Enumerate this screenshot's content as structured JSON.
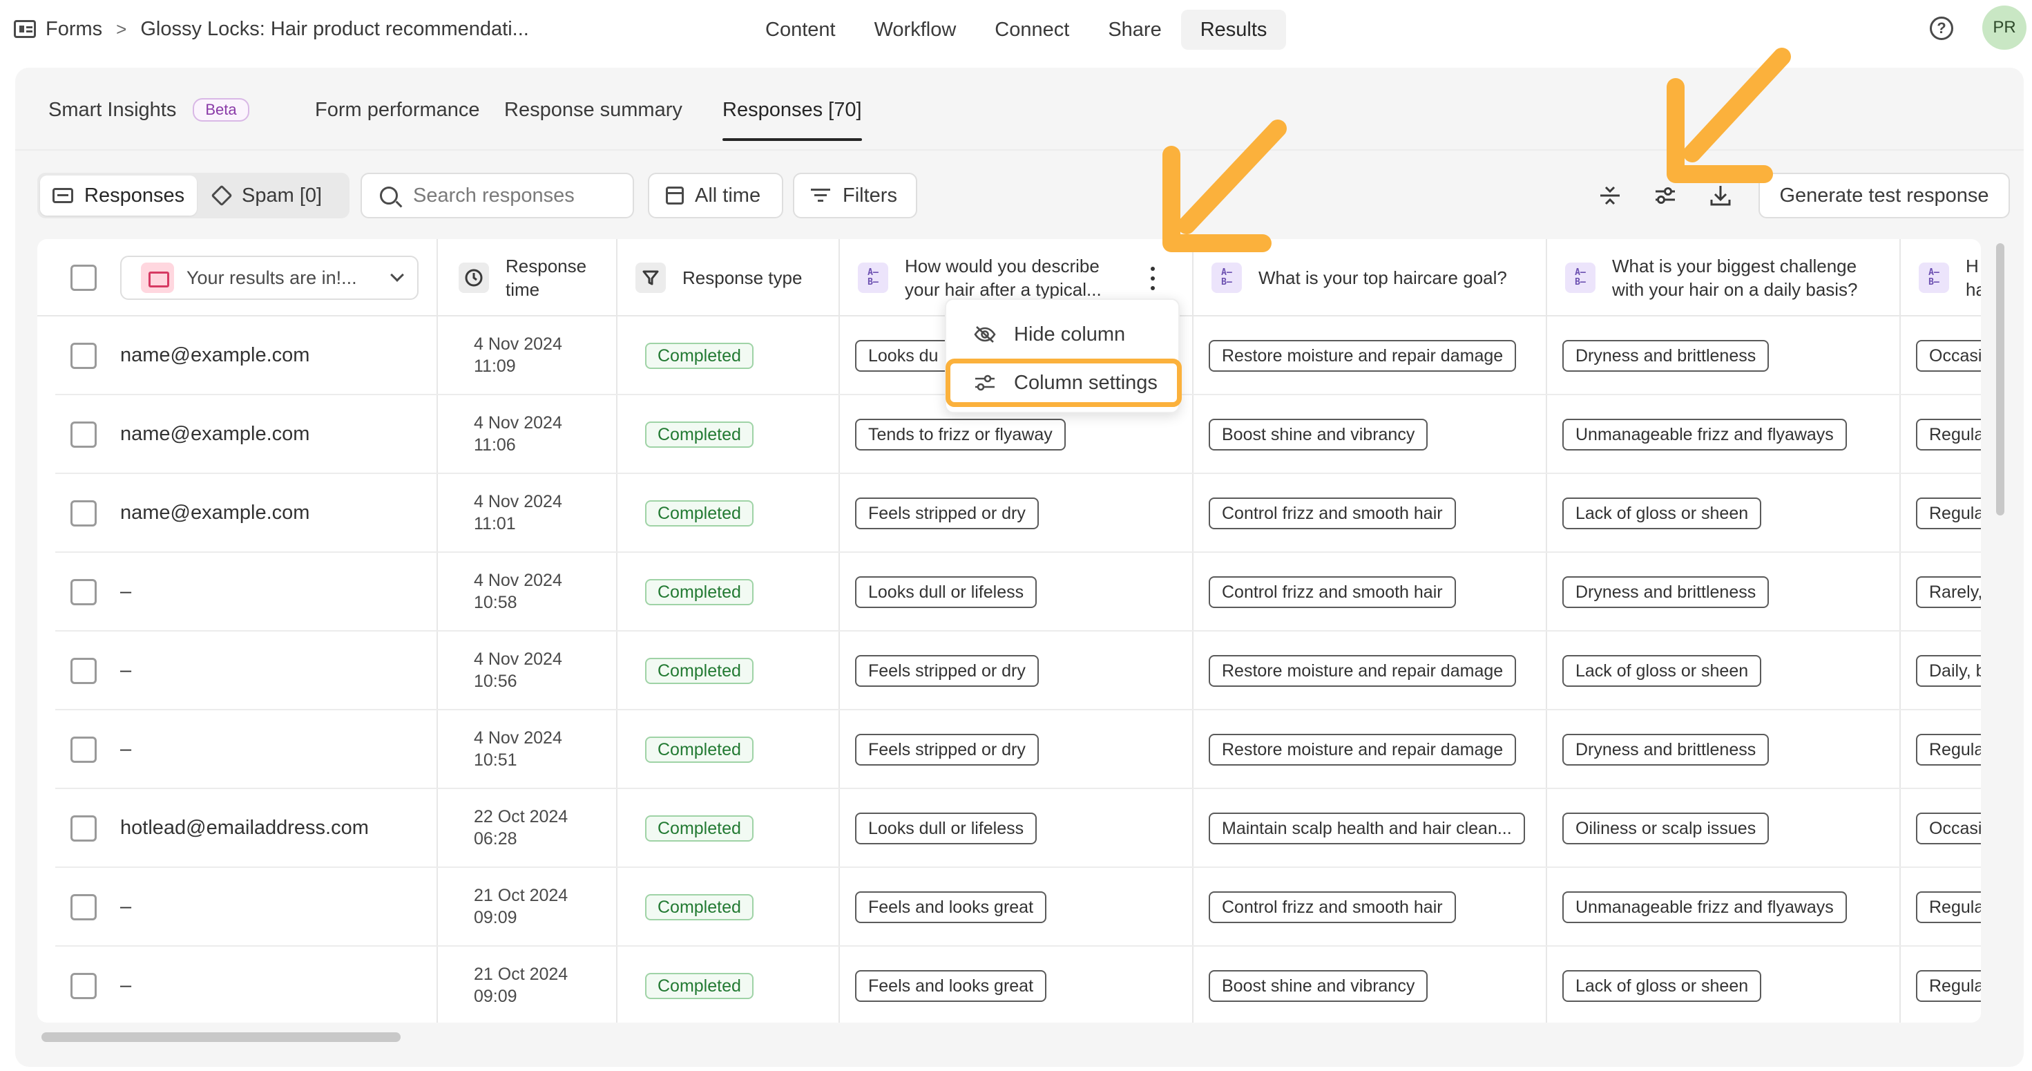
{
  "breadcrumb": {
    "root": "Forms",
    "separator": ">",
    "form_title": "Glossy Locks: Hair product recommendati..."
  },
  "top_nav": [
    {
      "label": "Content",
      "active": false
    },
    {
      "label": "Workflow",
      "active": false
    },
    {
      "label": "Connect",
      "active": false
    },
    {
      "label": "Share",
      "active": false
    },
    {
      "label": "Results",
      "active": true
    }
  ],
  "user": {
    "initials": "PR",
    "help_icon": "question-circle-icon"
  },
  "sub_tabs": {
    "smart_insights": "Smart Insights",
    "beta_badge": "Beta",
    "form_performance": "Form performance",
    "response_summary": "Response summary",
    "responses": "Responses [70]"
  },
  "toolbar": {
    "responses_label": "Responses",
    "spam_label": "Spam [0]",
    "search_placeholder": "Search responses",
    "date_filter": "All time",
    "filters_label": "Filters",
    "generate_label": "Generate test response"
  },
  "table": {
    "email_column": "Your results are in!...",
    "response_time_header": "Response time",
    "response_type_header": "Response type",
    "questions": [
      "How would you describe your hair after a typical...",
      "What is your top haircare goal?",
      "What is your biggest challenge with your hair on a daily basis?",
      "H ha"
    ],
    "rows": [
      {
        "email": "name@example.com",
        "date": "4 Nov 2024",
        "time": "11:09",
        "type": "Completed",
        "q1": "Looks du",
        "q2": "Restore moisture and repair damage",
        "q3": "Dryness and brittleness",
        "q4": "Occasi"
      },
      {
        "email": "name@example.com",
        "date": "4 Nov 2024",
        "time": "11:06",
        "type": "Completed",
        "q1": "Tends to frizz or flyaway",
        "q2": "Boost shine and vibrancy",
        "q3": "Unmanageable frizz and flyaways",
        "q4": "Regula"
      },
      {
        "email": "name@example.com",
        "date": "4 Nov 2024",
        "time": "11:01",
        "type": "Completed",
        "q1": "Feels stripped or dry",
        "q2": "Control frizz and smooth hair",
        "q3": "Lack of gloss or sheen",
        "q4": "Regula"
      },
      {
        "email": "–",
        "date": "4 Nov 2024",
        "time": "10:58",
        "type": "Completed",
        "q1": "Looks dull or lifeless",
        "q2": "Control frizz and smooth hair",
        "q3": "Dryness and brittleness",
        "q4": "Rarely,"
      },
      {
        "email": "–",
        "date": "4 Nov 2024",
        "time": "10:56",
        "type": "Completed",
        "q1": "Feels stripped or dry",
        "q2": "Restore moisture and repair damage",
        "q3": "Lack of gloss or sheen",
        "q4": "Daily, b"
      },
      {
        "email": "–",
        "date": "4 Nov 2024",
        "time": "10:51",
        "type": "Completed",
        "q1": "Feels stripped or dry",
        "q2": "Restore moisture and repair damage",
        "q3": "Dryness and brittleness",
        "q4": "Regula"
      },
      {
        "email": "hotlead@emailaddress.com",
        "date": "22 Oct 2024",
        "time": "06:28",
        "type": "Completed",
        "q1": "Looks dull or lifeless",
        "q2": "Maintain scalp health and hair clean...",
        "q3": "Oiliness or scalp issues",
        "q4": "Occasi"
      },
      {
        "email": "–",
        "date": "21 Oct 2024",
        "time": "09:09",
        "type": "Completed",
        "q1": "Feels and looks great",
        "q2": "Control frizz and smooth hair",
        "q3": "Unmanageable frizz and flyaways",
        "q4": "Regula"
      },
      {
        "email": "–",
        "date": "21 Oct 2024",
        "time": "09:09",
        "type": "Completed",
        "q1": "Feels and looks great",
        "q2": "Boost shine and vibrancy",
        "q3": "Lack of gloss or sheen",
        "q4": "Regula"
      }
    ]
  },
  "column_menu": {
    "hide": "Hide column",
    "settings": "Column settings"
  },
  "colors": {
    "accent_highlight": "#fbb13c",
    "completed_green": "#237a33",
    "question_icon_purple": "#ece4fb"
  }
}
